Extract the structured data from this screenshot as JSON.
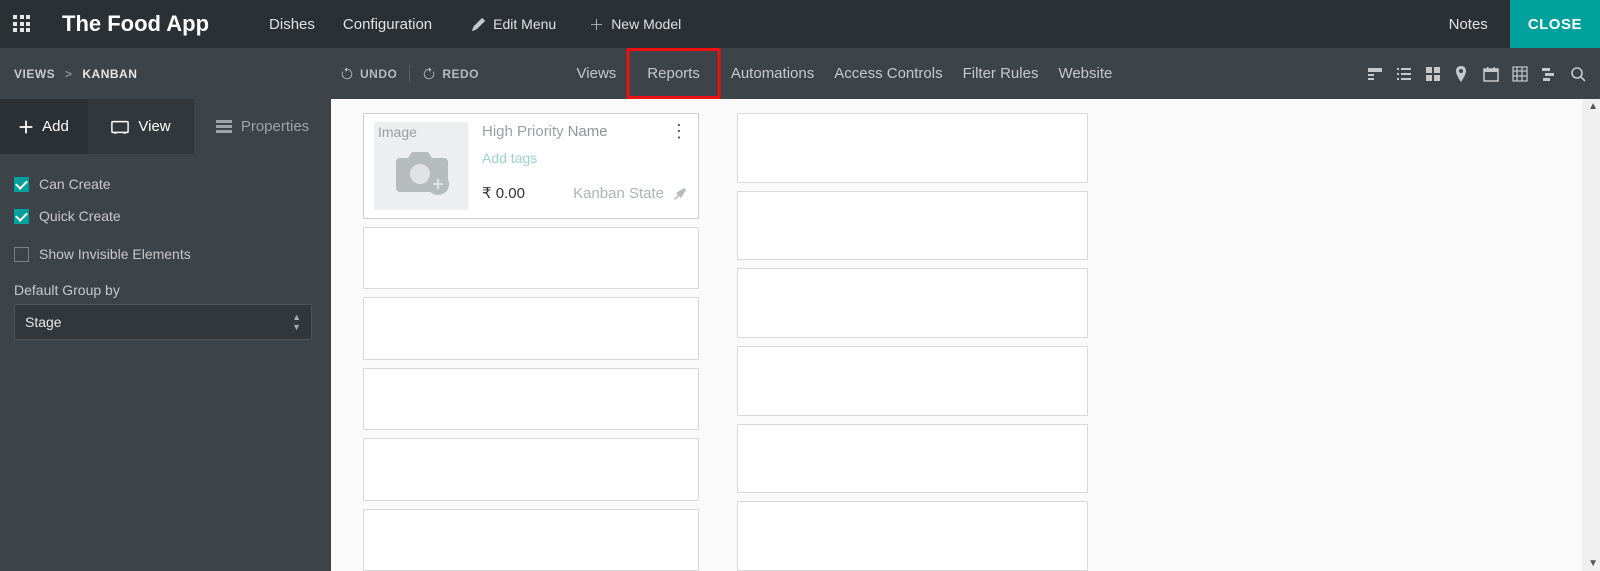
{
  "header": {
    "app_title": "The Food App",
    "menu": {
      "dishes": "Dishes",
      "configuration": "Configuration"
    },
    "edit_menu": "Edit Menu",
    "new_model": "New Model",
    "notes": "Notes",
    "close": "CLOSE"
  },
  "subbar": {
    "breadcrumb_root": "VIEWS",
    "breadcrumb_current": "KANBAN",
    "undo": "UNDO",
    "redo": "REDO",
    "tabs": {
      "views": "Views",
      "reports": "Reports",
      "automations": "Automations",
      "access": "Access Controls",
      "filter": "Filter Rules",
      "website": "Website"
    }
  },
  "sidebar": {
    "add": "Add",
    "view": "View",
    "properties": "Properties",
    "can_create": "Can Create",
    "quick_create": "Quick Create",
    "show_invisible": "Show Invisible Elements",
    "default_group_by": "Default Group by",
    "default_group_by_value": "Stage"
  },
  "card": {
    "image_label": "Image",
    "high_priority": "High Priority",
    "name_label": "Name",
    "add_tags": "Add tags",
    "price": "₹ 0.00",
    "kanban_state": "Kanban State"
  }
}
